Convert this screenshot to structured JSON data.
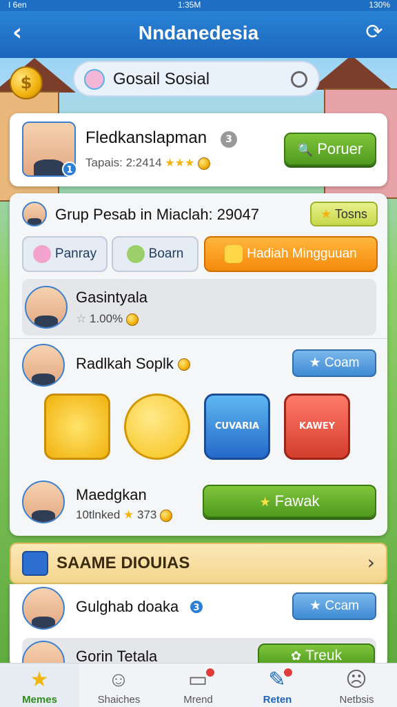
{
  "status_bar": {
    "carrier": "I 6en",
    "time": "1:35M",
    "battery": "130%"
  },
  "header": {
    "title": "Nndanedesia",
    "back_icon": "back-arrow-icon",
    "refresh_icon": "refresh-icon"
  },
  "search": {
    "text": "Gosail Sosial"
  },
  "profile": {
    "name": "Fledkanslapman",
    "level_badge": "3",
    "avatar_badge": "1",
    "stats": "Tapais: 2:2414",
    "button_label": "Poruer"
  },
  "group": {
    "title": "Grup Pesab in Miaclah: 29047",
    "badge_button": "Tosns",
    "tabs": [
      {
        "label": "Panray"
      },
      {
        "label": "Boarn"
      },
      {
        "label": "Hadiah Mingguuan"
      }
    ]
  },
  "members": [
    {
      "name": "Gasintyala",
      "sub": "1.00%"
    },
    {
      "name": "Radlkah Soplk",
      "button": "Coam"
    },
    {
      "name": "Maedgkan",
      "sub": "10tlnked",
      "sub2": "373",
      "button": "Fawak"
    }
  ],
  "stickers": [
    {
      "name": "gold-star-sticker"
    },
    {
      "name": "smiley-sticker"
    },
    {
      "name": "cuvaria-case-sticker",
      "text": "CUVARIA"
    },
    {
      "name": "kawey-box-sticker",
      "text": "KAWEY"
    }
  ],
  "section": {
    "label": "SAAME DIOUIAS",
    "rows": [
      {
        "name": "Gulghab doaka",
        "badge": "3",
        "button": "Ccam"
      },
      {
        "name": "Gorin Tetala",
        "button": "Treuk"
      }
    ]
  },
  "bottom_nav": [
    {
      "label": "Memes",
      "icon": "star-icon"
    },
    {
      "label": "Shaiches",
      "icon": "smile-icon"
    },
    {
      "label": "Mrend",
      "icon": "message-icon"
    },
    {
      "label": "Reten",
      "icon": "edit-icon"
    },
    {
      "label": "Netbsis",
      "icon": "sad-face-icon"
    }
  ],
  "colors": {
    "header": "#1b66bd",
    "green_button": "#4f9a1f",
    "orange_tab": "#f48a0c",
    "blue_button": "#3f8bd4"
  }
}
